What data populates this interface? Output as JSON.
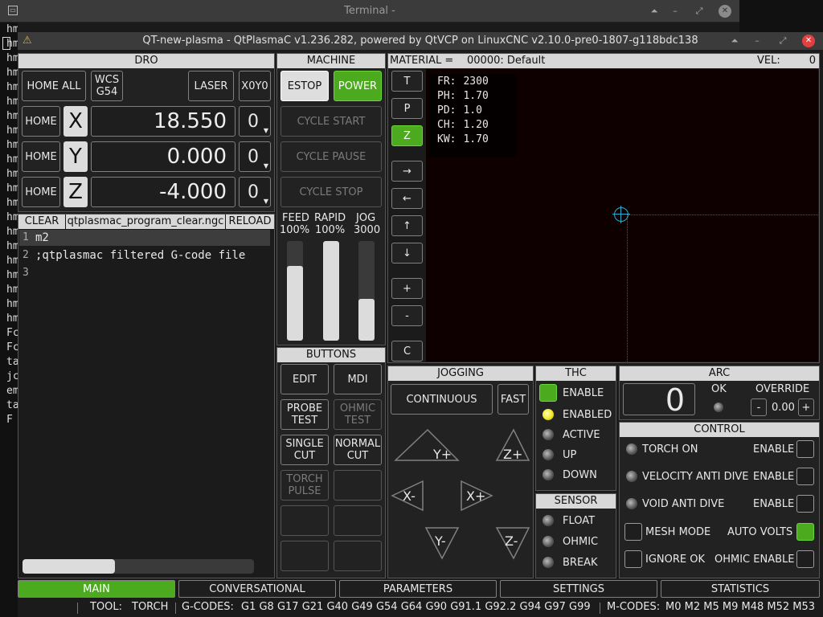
{
  "terminal": {
    "title": "Terminal -",
    "lines": [
      "hm",
      "hm",
      "hm",
      "hm",
      "hm",
      "hm",
      "hm",
      "hm",
      "hm",
      "hm",
      "hm",
      "hm",
      "hm",
      "hm",
      "hm",
      "hm",
      "hm",
      "hm",
      "hm",
      "hm",
      "hm",
      "Fc",
      "Fc",
      "ta",
      "jc",
      "em",
      "ta",
      "F"
    ]
  },
  "window": {
    "title": "QT-new-plasma - QtPlasmaC v1.236.282, powered by QtVCP on LinuxCNC v2.10.0-pre0-1807-g118bdc138"
  },
  "dro": {
    "header": "DRO",
    "home_all": "HOME ALL",
    "wcs": "WCS\nG54",
    "laser": "LASER",
    "x0y0": "X0Y0",
    "axes": [
      {
        "home": "HOME",
        "axis": "X",
        "value": "18.550",
        "offset": "0"
      },
      {
        "home": "HOME",
        "axis": "Y",
        "value": "0.000",
        "offset": "0"
      },
      {
        "home": "HOME",
        "axis": "Z",
        "value": "-4.000",
        "offset": "0"
      }
    ]
  },
  "gcode": {
    "clear": "CLEAR",
    "filename": "qtplasmac_program_clear.ngc",
    "reload": "RELOAD",
    "lines": [
      {
        "n": "1",
        "text": "m2"
      },
      {
        "n": "2",
        "text": ";qtplasmac filtered G-code file"
      },
      {
        "n": "3",
        "text": ""
      }
    ],
    "scroll_fraction": 0.4
  },
  "machine": {
    "header": "MACHINE",
    "estop": "ESTOP",
    "power": "POWER",
    "cycle_start": "CYCLE START",
    "cycle_pause": "CYCLE PAUSE",
    "cycle_stop": "CYCLE STOP",
    "feed_label": "FEED",
    "feed_value": "100%",
    "rapid_label": "RAPID",
    "rapid_value": "100%",
    "jog_label": "JOG",
    "jog_value": "3000",
    "feed_level": 0.75,
    "rapid_level": 1.0,
    "jog_level": 0.42
  },
  "buttons": {
    "header": "BUTTONS",
    "edit": "EDIT",
    "mdi": "MDI",
    "probe_test": "PROBE\nTEST",
    "ohmic_test": "OHMIC\nTEST",
    "single_cut": "SINGLE\nCUT",
    "normal_cut": "NORMAL\nCUT",
    "torch_pulse": "TORCH\nPULSE"
  },
  "material": {
    "label": "MATERIAL = ",
    "value": "00000: Default",
    "vel_label": "VEL:",
    "vel_value": "0"
  },
  "view": {
    "buttons": [
      "T",
      "P",
      "Z",
      "→",
      "←",
      "↑",
      "↓",
      "+",
      "-",
      "C"
    ],
    "params": [
      {
        "k": "FR:",
        "v": "2300"
      },
      {
        "k": "PH:",
        "v": "1.70"
      },
      {
        "k": "PD:",
        "v": "1.0"
      },
      {
        "k": "CH:",
        "v": "1.20"
      },
      {
        "k": "KW:",
        "v": "1.70"
      }
    ]
  },
  "jogging": {
    "header": "JOGGING",
    "mode": "CONTINUOUS",
    "fast": "FAST",
    "yplus": "Y+",
    "zplus": "Z+",
    "xminus": "X-",
    "xplus": "X+",
    "yminus": "Y-",
    "zminus": "Z-"
  },
  "thc": {
    "header": "THC",
    "enable": "ENABLE",
    "enabled": "ENABLED",
    "active": "ACTIVE",
    "up": "UP",
    "down": "DOWN"
  },
  "sensor": {
    "header": "SENSOR",
    "float": "FLOAT",
    "ohmic": "OHMIC",
    "break": "BREAK"
  },
  "arc": {
    "header": "ARC",
    "voltage": "0",
    "ok": "OK",
    "override_label": "OVERRIDE",
    "minus": "-",
    "override_value": "0.00",
    "plus": "+"
  },
  "control": {
    "header": "CONTROL",
    "torch_on": "TORCH ON",
    "enable": "ENABLE",
    "velocity_anti_dive": "VELOCITY ANTI DIVE",
    "void_anti_dive": "VOID ANTI DIVE",
    "mesh_mode": "MESH MODE",
    "auto_volts": "AUTO VOLTS",
    "ignore_ok": "IGNORE OK",
    "ohmic_enable": "OHMIC ENABLE"
  },
  "tabs": [
    "MAIN",
    "CONVERSATIONAL",
    "PARAMETERS",
    "SETTINGS",
    "STATISTICS"
  ],
  "status": {
    "tool_label": "TOOL:",
    "tool": "TORCH",
    "gcodes_label": "G-CODES:",
    "gcodes": "G1 G8 G17 G21 G40 G49 G54 G64 G90 G91.1 G92.2 G94 G97 G99",
    "mcodes_label": "M-CODES:",
    "mcodes": "M0 M2 M5 M9 M48 M52 M53"
  },
  "colors": {
    "accent_green": "#4caa1e",
    "led_yellow": "#f1e82a",
    "preview_bg": "#0f0000",
    "preview_crosshair": "#2aaad4"
  }
}
